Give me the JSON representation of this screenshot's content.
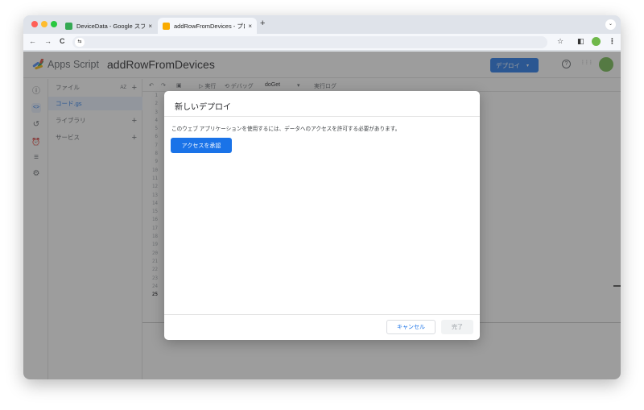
{
  "browser": {
    "tabs": [
      {
        "title": "DeviceData - Google スプレッ",
        "active": false,
        "favicon_color": "#34a853"
      },
      {
        "title": "addRowFromDevices - プロジ",
        "active": true,
        "favicon_color": "#f9ab00"
      }
    ],
    "new_tab_label": "+",
    "tab_close_label": "×",
    "nav": {
      "back": "←",
      "forward": "→",
      "reload": "C"
    },
    "address_bar": {
      "text": "",
      "site_icon": "⇆"
    },
    "toolbar_icons": {
      "bookmark": "☆",
      "sidepanel": "◧",
      "menu": "⋮"
    },
    "tab_menu": "⌄"
  },
  "app": {
    "brand": "Apps Script",
    "project_title": "addRowFromDevices",
    "deploy_label": "デプロイ",
    "deploy_caret": "▾",
    "header_icons": {
      "help": "?",
      "apps": "⋮⋮⋮"
    },
    "rail_icons": [
      "overview-icon",
      "editor-icon",
      "history-icon",
      "triggers-icon",
      "executions-icon",
      "settings-icon"
    ],
    "rail_glyphs": [
      "ⓘ",
      "<>",
      "↺",
      "⏰",
      "≡",
      "⚙"
    ],
    "files": {
      "header": "ファイル",
      "header_sort": "AZ",
      "header_plus": "+",
      "items": [
        {
          "label": "コード.gs"
        }
      ],
      "libraries": "ライブラリ",
      "services": "サービス",
      "plus": "+"
    },
    "editor_toolbar": {
      "undo": "↶",
      "redo": "↷",
      "save": "▣",
      "run": "▷ 実行",
      "debug": "⟲ デバッグ",
      "function": "doGet",
      "function_caret": "▾",
      "exec_log": "実行ログ"
    },
    "line_numbers": [
      "1",
      "2",
      "3",
      "4",
      "5",
      "6",
      "7",
      "8",
      "9",
      "10",
      "11",
      "12",
      "13",
      "14",
      "15",
      "16",
      "17",
      "18",
      "19",
      "20",
      "21",
      "22",
      "23",
      "24",
      "25"
    ],
    "current_line": "25"
  },
  "dialog": {
    "title": "新しいデプロイ",
    "message": "このウェブ アプリケーションを使用するには、データへのアクセスを許可する必要があります。",
    "authorize_label": "アクセスを承認",
    "cancel_label": "キャンセル",
    "done_label": "完了"
  },
  "colors": {
    "accent": "#1a73e8",
    "scrim": "rgba(60,60,60,0.5)"
  }
}
